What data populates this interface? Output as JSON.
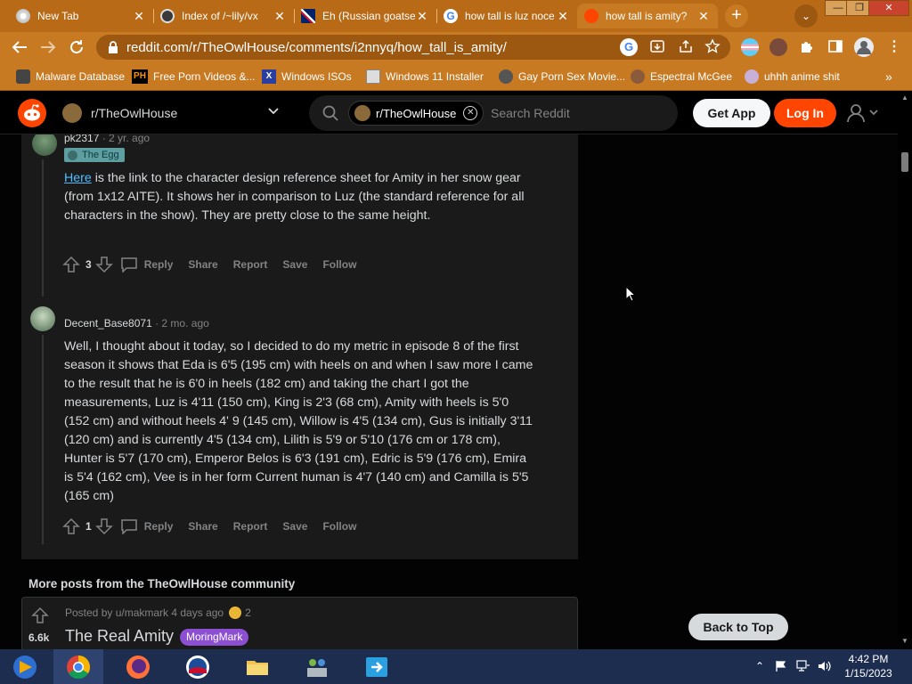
{
  "browser": {
    "tabs": [
      {
        "title": "New Tab",
        "icon": "chrome-icon"
      },
      {
        "title": "Index of /~lily/vx",
        "icon": "owl-icon"
      },
      {
        "title": "Eh (Russian goatse",
        "icon": "uk-flag-icon"
      },
      {
        "title": "how tall is luz noce",
        "icon": "google-icon"
      },
      {
        "title": "how tall is amity?",
        "icon": "reddit-icon"
      }
    ],
    "url": "reddit.com/r/TheOwlHouse/comments/i2nnyq/how_tall_is_amity/",
    "bookmarks": [
      {
        "label": "Malware Database",
        "icon": "malware-icon"
      },
      {
        "label": "Free Porn Videos &...",
        "icon": "ph-icon",
        "badge": "PH"
      },
      {
        "label": "Windows ISOs",
        "icon": "x-icon",
        "badge": "X"
      },
      {
        "label": "Windows 11 Installer",
        "icon": "installer-icon"
      },
      {
        "label": "Gay Porn Sex Movie...",
        "icon": "gear-site-icon"
      },
      {
        "label": "Espectral McGee",
        "icon": "character-icon"
      },
      {
        "label": "uhhh anime shit",
        "icon": "anime-icon"
      }
    ],
    "bookmarks_more": "»",
    "tab_close": "✕",
    "new_tab": "+",
    "tab_dropdown": "⌄",
    "window": {
      "minimize": "—",
      "restore": "❐",
      "close": "✕"
    }
  },
  "reddit": {
    "subreddit": "r/TheOwlHouse",
    "search_chip": "r/TheOwlHouse",
    "search_placeholder": "Search Reddit",
    "get_app": "Get App",
    "log_in": "Log In",
    "comments": [
      {
        "author": "pk2317",
        "time": "· 2 yr. ago",
        "flair": "The Egg",
        "link_text": "Here",
        "body": " is the link to the character design reference sheet for Amity in her snow gear (from 1x12 AITE). It shows her in comparison to Luz (the standard reference for all characters in the show). They are pretty close to the same height.",
        "score": "3"
      },
      {
        "author": "Decent_Base8071",
        "time": "· 2 mo. ago",
        "body": "Well, I thought about it today, so I decided to do my metric in episode 8 of the first season it shows that Eda is 6'5 (195 cm) with heels on and when I saw more I came to the result that he is 6'0 in heels (182 cm) and taking the chart I got the measurements, Luz is 4'11 (150 cm), King is 2'3 (68 cm), Amity with heels is 5'0 (152 cm) and without heels 4' 9 (145 cm), Willow is 4'5 (134 cm), Gus is initially 3'11 (120 cm) and is currently 4'5 (134 cm), Lilith is 5'9 or 5'10 (176 cm or 178 cm), Hunter is 5'7 (170 cm), Emperor Belos is 6'3 (191 cm), Edric is 5'9 (176 cm), Emira is 5'4 (162 cm), Vee is in her form Current human is 4'7 (140 cm) and Camilla is 5'5 (165 cm)",
        "score": "1"
      }
    ],
    "actions": {
      "reply": "Reply",
      "share": "Share",
      "report": "Report",
      "save": "Save",
      "follow": "Follow"
    },
    "more_header": "More posts from the TheOwlHouse community",
    "more_post": {
      "score": "6.6k",
      "meta": "Posted by u/makmark 4 days ago",
      "award_count": "2",
      "title": "The Real Amity",
      "flair": "MoringMark"
    },
    "back_to_top": "Back to Top"
  },
  "taskbar": {
    "time": "4:42 PM",
    "date": "1/15/2023",
    "apps": [
      "windows-media-icon",
      "chrome-icon",
      "firefox-icon",
      "obama-icon",
      "file-explorer-icon",
      "network-users-icon",
      "remote-app-icon"
    ]
  },
  "colors": {
    "chrome_accent": "#c77a22",
    "reddit_orange": "#ff4500",
    "card_bg": "#1a1a1b",
    "text": "#d7dadc",
    "meta": "#818384",
    "flair_mark": "#8c4fd1"
  }
}
